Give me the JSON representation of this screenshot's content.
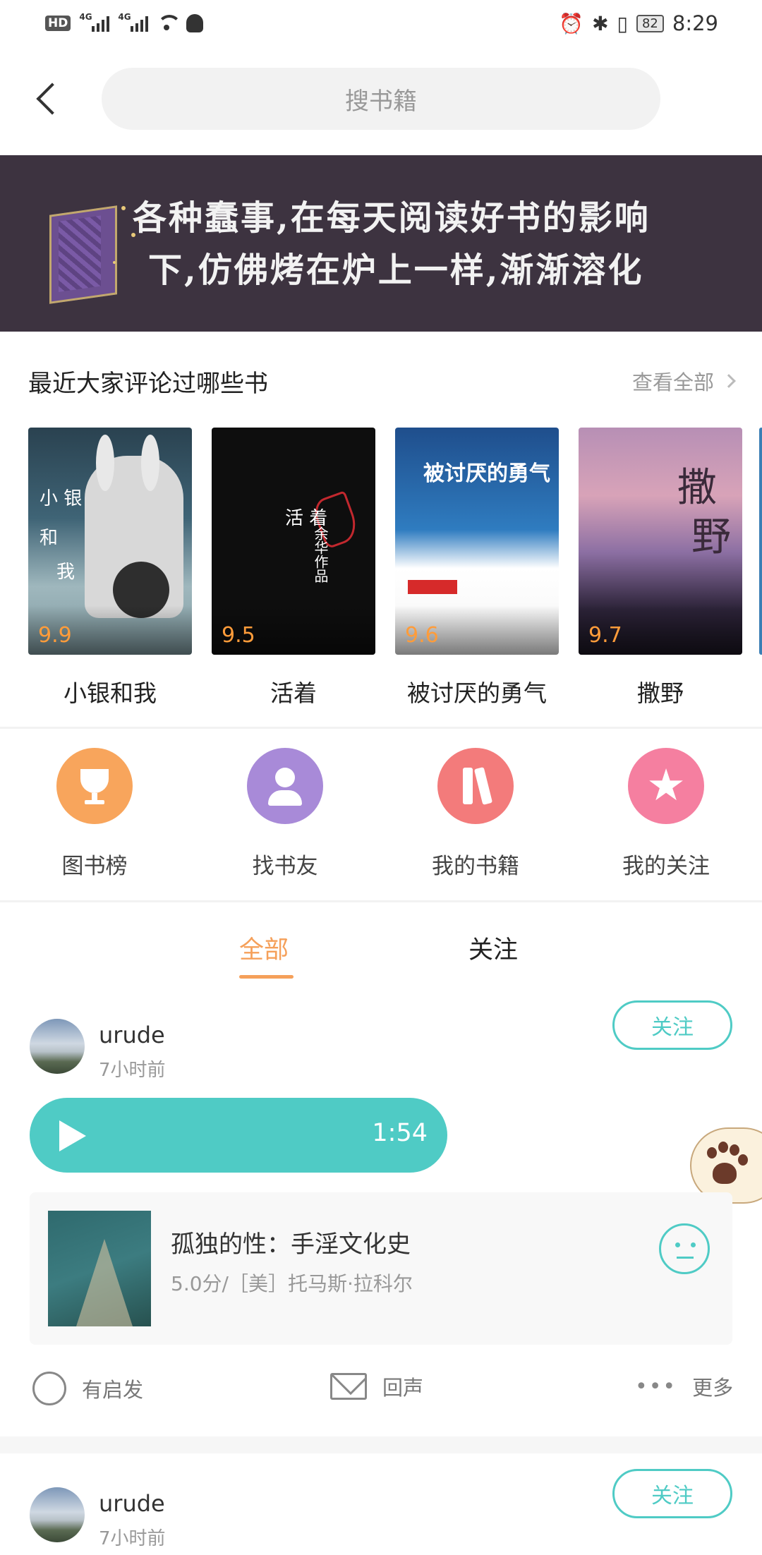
{
  "status_bar": {
    "hd_label": "HD",
    "sim1_label": "4G",
    "sim2_label": "4G",
    "battery": "82",
    "time": "8:29"
  },
  "header": {
    "search_placeholder": "搜书籍"
  },
  "banner": {
    "line1": "各种蠢事,在每天阅读好书的影响",
    "line2": "下,仿佛烤在炉上一样,渐渐溶化"
  },
  "recent_section": {
    "title": "最近大家评论过哪些书",
    "see_all": "查看全部",
    "books": [
      {
        "title": "小银和我",
        "score": "9.9"
      },
      {
        "title": "活着",
        "score": "9.5"
      },
      {
        "title": "被讨厌的勇气",
        "score": "9.6"
      },
      {
        "title": "撒野",
        "score": "9.7"
      }
    ]
  },
  "quick_actions": [
    {
      "label": "图书榜",
      "icon": "trophy-icon",
      "color": "#f8a55c"
    },
    {
      "label": "找书友",
      "icon": "friends-icon",
      "color": "#a88ad8"
    },
    {
      "label": "我的书籍",
      "icon": "books-icon",
      "color": "#f37b7b"
    },
    {
      "label": "我的关注",
      "icon": "star-icon",
      "color": "#f57fa0"
    }
  ],
  "tabs": {
    "all": "全部",
    "following": "关注"
  },
  "posts": [
    {
      "username": "urude",
      "time": "7小时前",
      "follow_label": "关注",
      "audio_duration": "1:54",
      "book": {
        "title": "孤独的性：手淫文化史",
        "sub": "5.0分/［美］托马斯·拉科尔"
      },
      "actions": {
        "inspire": "有启发",
        "reply": "回声",
        "more": "更多"
      }
    },
    {
      "username": "urude",
      "time": "7小时前",
      "follow_label": "关注"
    }
  ],
  "colors": {
    "accent_teal": "#4fcbc5",
    "accent_orange": "#f5a05a",
    "score_orange": "#ff9c3a"
  }
}
